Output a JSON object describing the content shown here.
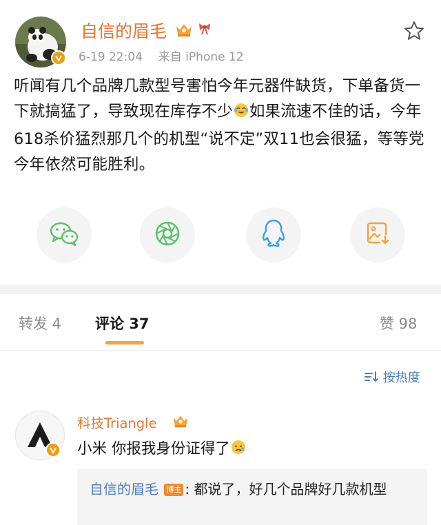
{
  "post": {
    "username": "自信的眉毛",
    "time": "6-19 22:04",
    "source": "来自 iPhone 12",
    "text_part1": "听闻有几个品牌几款型号害怕今年元器件缺货，下单备货一下就搞猛了，导致现在库存不少",
    "text_part2": "如果流速不佳的话，今年618杀价猛烈那几个的机型“说不定”双11也会很猛，等等党今年依然可能胜利。"
  },
  "share": {
    "icons": [
      "wechat-icon",
      "moments-icon",
      "qq-icon",
      "save-image-icon"
    ],
    "colors": {
      "wechat": "#5cc26a",
      "moments": "#5cc26a",
      "qq": "#3aa0e8",
      "save": "#f2a33a"
    }
  },
  "tabs": {
    "repost_label": "转发 4",
    "comment_label": "评论 37",
    "like_label": "赞 98"
  },
  "sort": {
    "label": "按热度"
  },
  "comment": {
    "username": "科技Triangle",
    "text": "小米 你报我身份证得了"
  },
  "reply": {
    "username": "自信的眉毛",
    "tag": "博主",
    "text": ": 都说了，好几个品牌好几款机型"
  },
  "colors": {
    "accent": "#e8772e",
    "link": "#4d7fbd",
    "indicator": "#f7a23c"
  }
}
